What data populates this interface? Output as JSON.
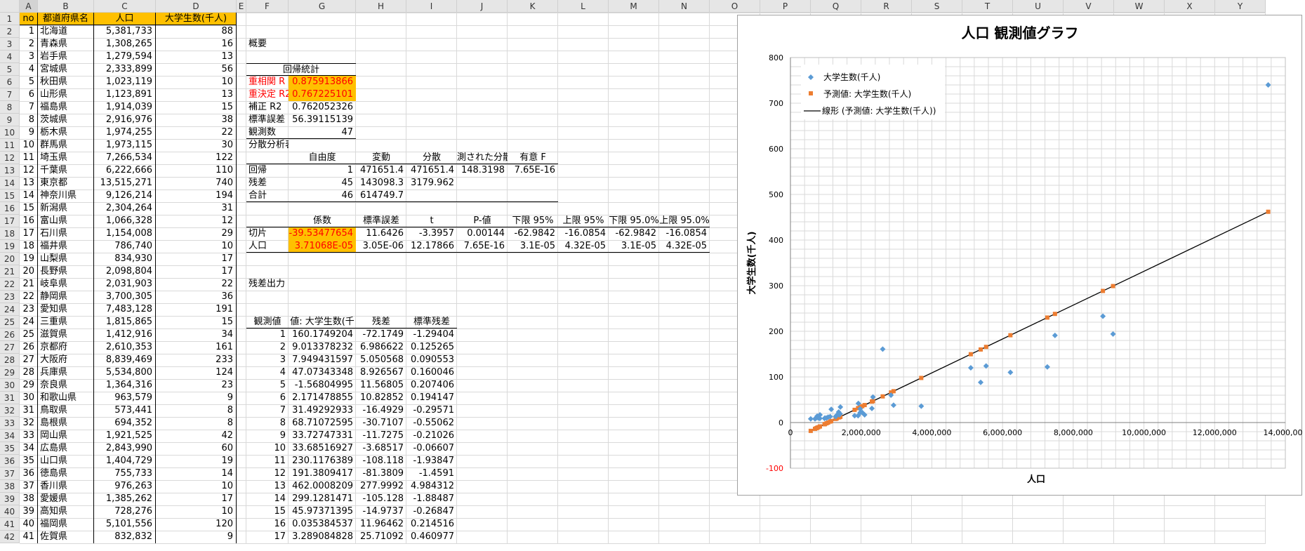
{
  "columns": [
    "A",
    "B",
    "C",
    "D",
    "E",
    "F",
    "G",
    "H",
    "I",
    "J",
    "K",
    "L",
    "M",
    "N",
    "O",
    "P",
    "Q",
    "R",
    "S",
    "T",
    "U",
    "V",
    "W",
    "X",
    "Y"
  ],
  "data_table": {
    "header": [
      "no",
      "都道府県名",
      "人口",
      "大学生数(千人)"
    ],
    "rows": [
      [
        "1",
        "北海道",
        "5,381,733",
        "88"
      ],
      [
        "2",
        "青森県",
        "1,308,265",
        "16"
      ],
      [
        "3",
        "岩手県",
        "1,279,594",
        "13"
      ],
      [
        "4",
        "宮城県",
        "2,333,899",
        "56"
      ],
      [
        "5",
        "秋田県",
        "1,023,119",
        "10"
      ],
      [
        "6",
        "山形県",
        "1,123,891",
        "13"
      ],
      [
        "7",
        "福島県",
        "1,914,039",
        "15"
      ],
      [
        "8",
        "茨城県",
        "2,916,976",
        "38"
      ],
      [
        "9",
        "栃木県",
        "1,974,255",
        "22"
      ],
      [
        "10",
        "群馬県",
        "1,973,115",
        "30"
      ],
      [
        "11",
        "埼玉県",
        "7,266,534",
        "122"
      ],
      [
        "12",
        "千葉県",
        "6,222,666",
        "110"
      ],
      [
        "13",
        "東京都",
        "13,515,271",
        "740"
      ],
      [
        "14",
        "神奈川県",
        "9,126,214",
        "194"
      ],
      [
        "15",
        "新潟県",
        "2,304,264",
        "31"
      ],
      [
        "16",
        "富山県",
        "1,066,328",
        "12"
      ],
      [
        "17",
        "石川県",
        "1,154,008",
        "29"
      ],
      [
        "18",
        "福井県",
        "786,740",
        "10"
      ],
      [
        "19",
        "山梨県",
        "834,930",
        "17"
      ],
      [
        "20",
        "長野県",
        "2,098,804",
        "17"
      ],
      [
        "21",
        "岐阜県",
        "2,031,903",
        "22"
      ],
      [
        "22",
        "静岡県",
        "3,700,305",
        "36"
      ],
      [
        "23",
        "愛知県",
        "7,483,128",
        "191"
      ],
      [
        "24",
        "三重県",
        "1,815,865",
        "15"
      ],
      [
        "25",
        "滋賀県",
        "1,412,916",
        "34"
      ],
      [
        "26",
        "京都府",
        "2,610,353",
        "161"
      ],
      [
        "27",
        "大阪府",
        "8,839,469",
        "233"
      ],
      [
        "28",
        "兵庫県",
        "5,534,800",
        "124"
      ],
      [
        "29",
        "奈良県",
        "1,364,316",
        "23"
      ],
      [
        "30",
        "和歌山県",
        "963,579",
        "9"
      ],
      [
        "31",
        "鳥取県",
        "573,441",
        "8"
      ],
      [
        "32",
        "島根県",
        "694,352",
        "8"
      ],
      [
        "33",
        "岡山県",
        "1,921,525",
        "42"
      ],
      [
        "34",
        "広島県",
        "2,843,990",
        "60"
      ],
      [
        "35",
        "山口県",
        "1,404,729",
        "19"
      ],
      [
        "36",
        "徳島県",
        "755,733",
        "14"
      ],
      [
        "37",
        "香川県",
        "976,263",
        "10"
      ],
      [
        "38",
        "愛媛県",
        "1,385,262",
        "17"
      ],
      [
        "39",
        "高知県",
        "728,276",
        "10"
      ],
      [
        "40",
        "福岡県",
        "5,101,556",
        "120"
      ],
      [
        "41",
        "佐賀県",
        "832,832",
        "9"
      ]
    ]
  },
  "summary": {
    "title": "概要",
    "reg_stats_title": "回帰統計",
    "reg_stats": [
      {
        "label": "重相関 R",
        "value": "0.875913866",
        "highlight": true,
        "red": true
      },
      {
        "label": "重決定 R2",
        "value": "0.767225101",
        "highlight": true,
        "red": true
      },
      {
        "label": "補正 R2",
        "value": "0.762052326"
      },
      {
        "label": "標準誤差",
        "value": "56.39115139"
      },
      {
        "label": "観測数",
        "value": "47"
      }
    ],
    "anova_title": "分散分析表",
    "anova_header": [
      "",
      "自由度",
      "変動",
      "分散",
      "測された分散",
      "有意 F"
    ],
    "anova_rows": [
      [
        "回帰",
        "1",
        "471651.4",
        "471651.4",
        "148.3198",
        "7.65E-16"
      ],
      [
        "残差",
        "45",
        "143098.3",
        "3179.962",
        "",
        ""
      ],
      [
        "合計",
        "46",
        "614749.7",
        "",
        "",
        ""
      ]
    ],
    "coef_header": [
      "",
      "係数",
      "標準誤差",
      "t",
      "P-値",
      "下限 95%",
      "上限 95%",
      "下限 95.0%",
      "上限 95.0%"
    ],
    "coef_rows": [
      [
        "切片",
        "-39.53477654",
        "11.6426",
        "-3.3957",
        "0.00144",
        "-62.9842",
        "-16.0854",
        "-62.9842",
        "-16.0854"
      ],
      [
        "人口",
        "3.71068E-05",
        "3.05E-06",
        "12.17866",
        "7.65E-16",
        "3.1E-05",
        "4.32E-05",
        "3.1E-05",
        "4.32E-05"
      ]
    ],
    "resid_title": "残差出力",
    "resid_header": [
      "観測値",
      "値: 大学生数(千",
      "残差",
      "標準残差"
    ],
    "resid_rows": [
      [
        "1",
        "160.1749204",
        "-72.1749",
        "-1.29404"
      ],
      [
        "2",
        "9.013378232",
        "6.986622",
        "0.125265"
      ],
      [
        "3",
        "7.949431597",
        "5.050568",
        "0.090553"
      ],
      [
        "4",
        "47.07343348",
        "8.926567",
        "0.160046"
      ],
      [
        "5",
        "-1.56804995",
        "11.56805",
        "0.207406"
      ],
      [
        "6",
        "2.171478855",
        "10.82852",
        "0.194147"
      ],
      [
        "7",
        "31.49292933",
        "-16.4929",
        "-0.29571"
      ],
      [
        "8",
        "68.71072595",
        "-30.7107",
        "-0.55062"
      ],
      [
        "9",
        "33.72747331",
        "-11.7275",
        "-0.21026"
      ],
      [
        "10",
        "33.68516927",
        "-3.68517",
        "-0.06607"
      ],
      [
        "11",
        "230.1176389",
        "-108.118",
        "-1.93847"
      ],
      [
        "12",
        "191.3809417",
        "-81.3809",
        "-1.4591"
      ],
      [
        "13",
        "462.0008209",
        "277.9992",
        "4.984312"
      ],
      [
        "14",
        "299.1281471",
        "-105.128",
        "-1.88487"
      ],
      [
        "15",
        "45.97371395",
        "-14.9737",
        "-0.26847"
      ],
      [
        "16",
        "0.035384537",
        "11.96462",
        "0.214516"
      ],
      [
        "17",
        "3.289084828",
        "25.71092",
        "0.460977"
      ]
    ]
  },
  "colors": {
    "header_fill": "#ffc000",
    "highlight_fill": "#ffc000",
    "red_text": "#ff0000",
    "series_actual": "#5b9bd5",
    "series_pred": "#ed7d31",
    "trend": "#000000"
  },
  "chart_data": {
    "type": "scatter",
    "title": "人口 観測値グラフ",
    "xlabel": "人口",
    "ylabel": "大学生数(千人)",
    "xlim": [
      0,
      14000000
    ],
    "ylim": [
      -100,
      800
    ],
    "xticks": [
      "0",
      "2,000,000",
      "4,000,000",
      "6,000,000",
      "8,000,000",
      "10,000,000",
      "12,000,000",
      "14,000,000"
    ],
    "yticks": [
      "-100",
      "0",
      "100",
      "200",
      "300",
      "400",
      "500",
      "600",
      "700",
      "800"
    ],
    "legend": [
      "大学生数(千人)",
      "予測値: 大学生数(千人)",
      "線形 (予測値: 大学生数(千人))"
    ],
    "legend_position": "top-left",
    "grid": true,
    "x": [
      5381733,
      1308265,
      1279594,
      2333899,
      1023119,
      1123891,
      1914039,
      2916976,
      1974255,
      1973115,
      7266534,
      6222666,
      13515271,
      9126214,
      2304264,
      1066328,
      1154008,
      786740,
      834930,
      2098804,
      2031903,
      3700305,
      7483128,
      1815865,
      1412916,
      2610353,
      8839469,
      5534800,
      1364316,
      963579,
      573441,
      694352,
      1921525,
      2843990,
      1404729,
      755733,
      976263,
      1385262,
      728276,
      5101556,
      832832
    ],
    "series": [
      {
        "name": "大学生数(千人)",
        "values": [
          88,
          16,
          13,
          56,
          10,
          13,
          15,
          38,
          22,
          30,
          122,
          110,
          740,
          194,
          31,
          12,
          29,
          10,
          17,
          17,
          22,
          36,
          191,
          15,
          34,
          161,
          233,
          124,
          23,
          9,
          8,
          8,
          42,
          60,
          19,
          14,
          10,
          17,
          10,
          120,
          9
        ]
      },
      {
        "name": "予測値: 大学生数(千人)",
        "values": [
          160.17,
          9.01,
          7.95,
          47.07,
          -1.57,
          2.17,
          31.49,
          68.71,
          33.73,
          33.69,
          230.12,
          191.38,
          462.0,
          299.13,
          45.97,
          0.04,
          3.29,
          -10.34,
          -8.55,
          38.35,
          35.86,
          97.77,
          238.13,
          27.85,
          12.89,
          57.33,
          288.47,
          165.84,
          11.09,
          -3.78,
          -18.26,
          -13.77,
          31.77,
          65.99,
          12.59,
          -11.49,
          -3.31,
          11.87,
          -12.51,
          149.77,
          -8.63
        ]
      }
    ]
  }
}
